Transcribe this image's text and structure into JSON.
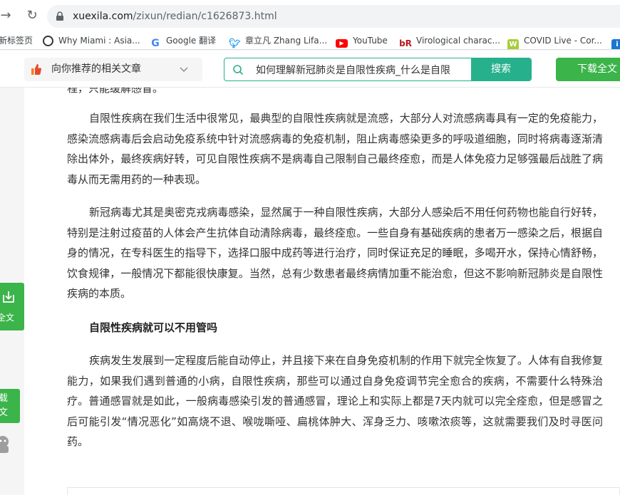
{
  "browser": {
    "url_host": "xuexila.com",
    "url_path": "/zixun/redian/c1626873.html",
    "bookmarks": [
      {
        "label": "新标签页",
        "icon": "none"
      },
      {
        "label": "Why Miami : Asia...",
        "icon": "globe-icon"
      },
      {
        "label": "Google 翻译",
        "icon": "google-icon"
      },
      {
        "label": "章立凡 Zhang Lifa...",
        "icon": "twitter-icon"
      },
      {
        "label": "YouTube",
        "icon": "youtube-icon"
      },
      {
        "label": "Virological charac...",
        "icon": "br-icon"
      },
      {
        "label": "COVID Live - Cor...",
        "icon": "w-icon"
      },
      {
        "label": "",
        "icon": "blue-icon"
      }
    ]
  },
  "toolbar": {
    "recommend_label": "向你推荐的相关文章",
    "search_value": "如何理解新冠肺炎是自限性疾病_什么是自限",
    "search_button": "搜索",
    "download_button": "下载全文"
  },
  "article": {
    "cut_line": "程，只能缓解感冒。",
    "p1": "自限性疾病在我们生活中很常见，最典型的自限性疾病就是流感，大部分人对流感病毒具有一定的免疫能力，感染流感病毒后会启动免疫系统中针对流感病毒的免疫机制，阻止病毒感染更多的呼吸道细胞，同时将病毒逐渐清除出体外，最终疾病好转，可见自限性疾病不是病毒自己限制自己最终痊愈，而是人体免疫力足够强最后战胜了病毒从而无需用药的一种表现。",
    "p2": "新冠病毒尤其是奥密克戎病毒感染，显然属于一种自限性疾病，大部分人感染后不用任何药物也能自行好转，特别是注射过疫苗的人体会产生抗体自动清除病毒，最终痊愈。一些自身有基础疾病的患者万一感染之后，根据自身的情况，在专科医生的指导下，选择口服中成药等进行治疗，同时保证充足的睡眠，多喝开水，保持心情舒畅，饮食规律，一般情况下都能很快康复。当然，总有少数患者最终病情加重不能治愈，但这不影响新冠肺炎是自限性疾病的本质。",
    "heading": "自限性疾病就可以不用管吗",
    "p3": "疾病发生发展到一定程度后能自动停止，并且接下来在自身免疫机制的作用下就完全恢复了。人体有自我修复能力，如果我们遇到普通的小病，自限性疾病，那些可以通过自身免疫调节完全愈合的疾病，不需要什么特殊治疗。普通感冒就是如此，一般病毒感染引发的普通感冒，理论上和实际上都是7天内就可以完全痊愈，但是感冒之后可能引发“情况恶化”如高烧不退、喉咙嘶哑、扁桃体肿大、浑身乏力、咳嗽浓痰等，这就需要我们及时寻医问药。"
  },
  "side": {
    "save_label": "全文",
    "download_line1": "载",
    "download_line2": "文"
  },
  "colors": {
    "search_green": "#27b08c",
    "download_green": "#3bb44a"
  }
}
